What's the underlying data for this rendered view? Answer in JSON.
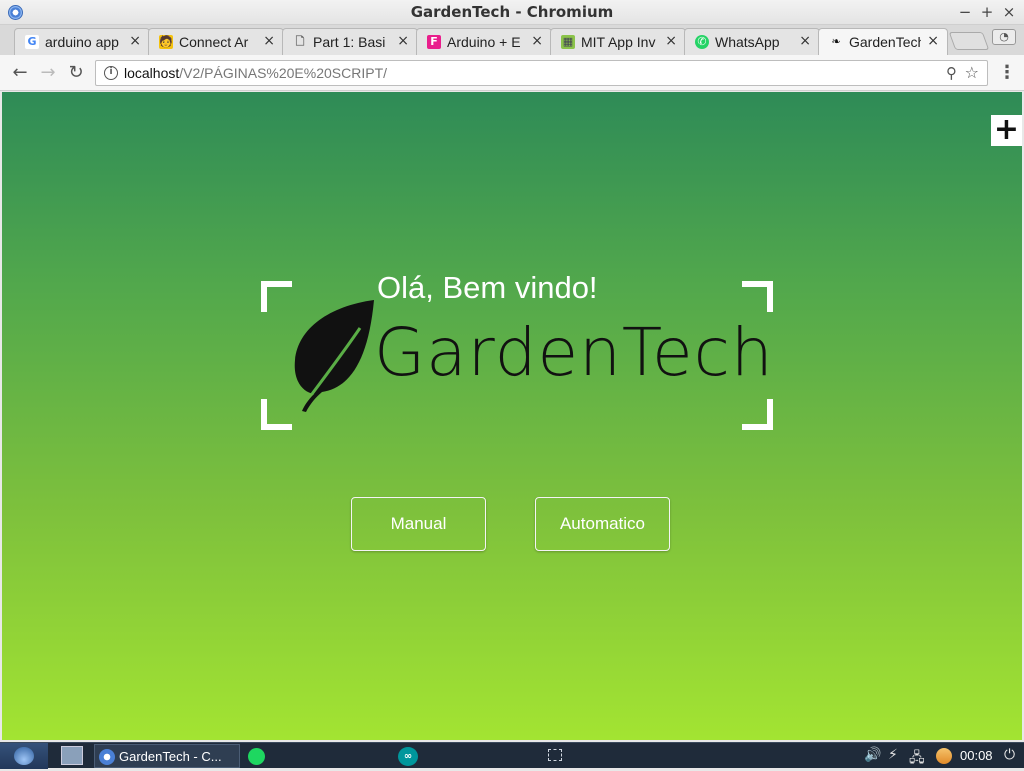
{
  "window": {
    "title": "GardenTech - Chromium",
    "controls": {
      "minimize": "−",
      "maximize": "+",
      "close": "×"
    }
  },
  "tabs": [
    {
      "label": "arduino app",
      "favicon_text": "G",
      "favicon_icon": "google-icon",
      "active": false
    },
    {
      "label": "Connect Ar",
      "favicon_text": "🧑",
      "favicon_icon": "instructables-icon",
      "active": false
    },
    {
      "label": "Part 1: Basi",
      "favicon_text": "🗋",
      "favicon_icon": "document-icon",
      "active": false
    },
    {
      "label": "Arduino + E",
      "favicon_text": "F",
      "favicon_icon": "flaticon-icon",
      "active": false
    },
    {
      "label": "MIT App Inv",
      "favicon_text": "▦",
      "favicon_icon": "mit-app-inventor-icon",
      "active": false
    },
    {
      "label": "WhatsApp",
      "favicon_text": "✆",
      "favicon_icon": "whatsapp-icon",
      "active": false
    },
    {
      "label": "GardenTech",
      "favicon_text": "❧",
      "favicon_icon": "leaf-icon",
      "active": true
    }
  ],
  "tab_close_glyph": "×",
  "toolbar": {
    "back": "←",
    "forward": "→",
    "reload": "↻",
    "url_host": "localhost",
    "url_path": "/V2/PÁGINAS%20E%20SCRIPT/",
    "info_glyph": "i",
    "zoom_glyph": "⚲",
    "star_glyph": "☆",
    "menu_glyph": "⋮"
  },
  "page": {
    "plus_button": "+",
    "welcome_text": "Olá, Bem vindo!",
    "brand_name": "GardenTech",
    "buttons": {
      "manual": "Manual",
      "automatic": "Automatico"
    },
    "colors": {
      "gradient_top": "#2e8b57",
      "gradient_bottom": "#a3e432",
      "leaf": "#111111"
    }
  },
  "taskbar": {
    "task_label": "GardenTech - C...",
    "arduino_glyph": "∞",
    "volume_glyph": "🔊",
    "power_glyph": "⚡",
    "network_glyph": "🖧",
    "shutdown_glyph": "⏻",
    "clock": "00:08"
  }
}
